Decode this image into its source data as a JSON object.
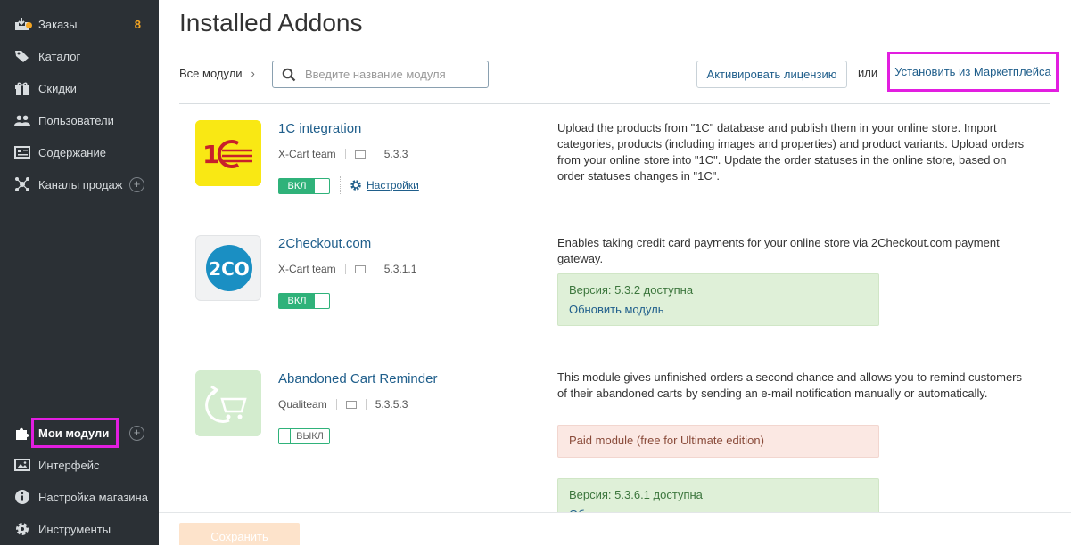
{
  "sidebar": {
    "items": [
      {
        "label": "Заказы",
        "count": "8",
        "icon": "orders-icon"
      },
      {
        "label": "Каталог",
        "icon": "tag-icon"
      },
      {
        "label": "Скидки",
        "icon": "gift-icon"
      },
      {
        "label": "Пользователи",
        "icon": "users-icon"
      },
      {
        "label": "Содержание",
        "icon": "content-icon"
      },
      {
        "label": "Каналы продаж",
        "icon": "channels-icon",
        "plus": "+"
      },
      {
        "label": "Мои модули",
        "icon": "puzzle-icon",
        "plus": "+",
        "active": true
      },
      {
        "label": "Интерфейс",
        "icon": "image-icon"
      },
      {
        "label": "Настройка магазина",
        "icon": "info-icon"
      },
      {
        "label": "Инструменты",
        "icon": "gear-icon"
      }
    ]
  },
  "header": {
    "title": "Installed Addons",
    "breadcrumb": "Все модули",
    "search_placeholder": "Введите название модуля",
    "activate_license": "Активировать лицензию",
    "or": "или",
    "marketplace": "Установить из Маркетплейса"
  },
  "modules": [
    {
      "title": "1C integration",
      "author": "X-Cart team",
      "version": "5.3.3",
      "state": "ВКЛ",
      "settings": "Настройки",
      "description": "Upload the products from \"1C\" database and publish them in your online store. Import categories, products (including images and properties) and product variants. Upload orders from your online store into \"1C\". Update the order statuses in the online store, based on order statuses changes in \"1C\"."
    },
    {
      "title": "2Checkout.com",
      "author": "X-Cart team",
      "version": "5.3.1.1",
      "state": "ВКЛ",
      "logo_text": "2CO",
      "description": "Enables taking credit card payments for your online store via 2Checkout.com payment gateway.",
      "notice_text": "Версия: 5.3.2 доступна",
      "notice_link": "Обновить модуль"
    },
    {
      "title": "Abandoned Cart Reminder",
      "author": "Qualiteam",
      "version": "5.3.5.3",
      "state": "ВЫКЛ",
      "description": "This module gives unfinished orders a second chance and allows you to remind customers of their abandoned carts by sending an e-mail notification manually or automatically.",
      "paid_notice": "Paid module (free for Ultimate edition)",
      "notice_text": "Версия: 5.3.6.1 доступна",
      "notice_link": "Обновить модуль"
    }
  ],
  "footer": {
    "save": "Сохранить"
  },
  "colors": {
    "sidebar_bg": "#2b3035",
    "accent_link": "#1f5e8b",
    "toggle_green": "#2fb27a",
    "highlight_magenta": "#e21ee0",
    "count_orange": "#f6a623"
  }
}
